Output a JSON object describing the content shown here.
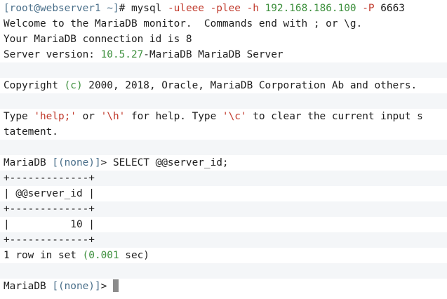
{
  "colors": {
    "background": "#ffffff",
    "text": "#1e1e1e",
    "prompt_muted": "#4a6f8a",
    "value_green": "#3c8f3c",
    "string_red": "#c0392b",
    "cursor": "#8c8c8c"
  },
  "shell_prompt": {
    "open_bracket": "[",
    "user_host": "root@webserver1 ~",
    "close_bracket": "]",
    "symbol": "# ",
    "command": "mysql ",
    "flag_user": "-uleee",
    "space1": " ",
    "flag_pass": "-plee",
    "space2": " ",
    "flag_host": "-h",
    "space3": " ",
    "host": "192.168.186.100",
    "space4": " ",
    "flag_port": "-P",
    "port": " 6663"
  },
  "welcome": {
    "line1": "Welcome to the MariaDB monitor.  Commands end with ; or \\g.",
    "line2": "Your MariaDB connection id is 8",
    "version_prefix": "Server version: ",
    "version": "10.5.27",
    "version_suffix": "-MariaDB MariaDB Server"
  },
  "copyright": {
    "prefix": "Copyright ",
    "c": "(c)",
    "rest": " 2000, 2018, Oracle, MariaDB Corporation Ab and others."
  },
  "help": {
    "t1": "Type ",
    "help_str": "'help;'",
    "t2": " or ",
    "h_str": "'\\h'",
    "t3": " for help. Type ",
    "c_str": "'\\c'",
    "t4": " to clear the current input s",
    "wrap": "tatement."
  },
  "query1": {
    "prompt_label": "MariaDB ",
    "db": "[(none)]",
    "prompt_end": "> ",
    "sql": "SELECT @@server_id;"
  },
  "result_table": {
    "border": "+-------------+",
    "header": "| @@server_id |",
    "row": "|          10 |"
  },
  "result_summary": {
    "prefix": "1 row in set ",
    "time": "(0.001",
    "suffix": " sec)"
  },
  "query2": {
    "prompt_label": "MariaDB ",
    "db": "[(none)]",
    "prompt_end": "> "
  }
}
